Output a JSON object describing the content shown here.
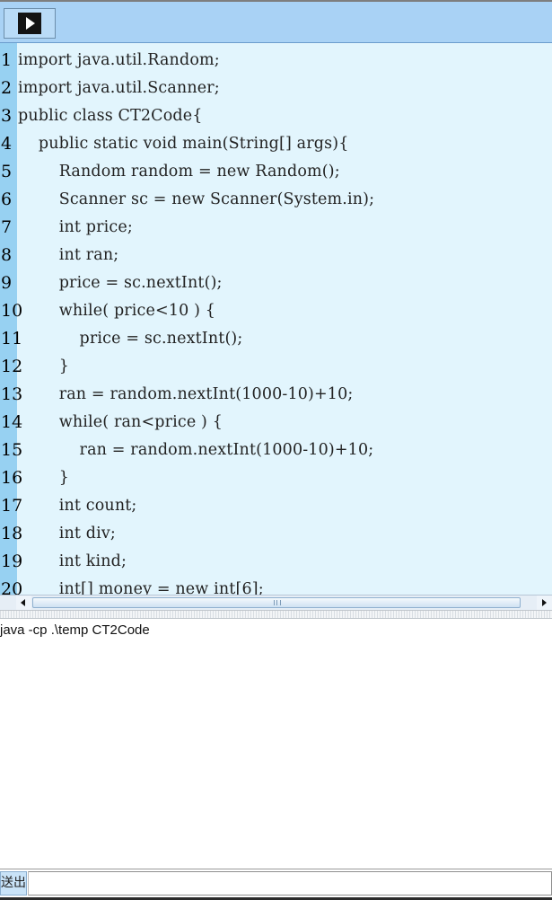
{
  "toolbar": {
    "run_icon": "play-icon"
  },
  "editor": {
    "lines": [
      {
        "num": "1",
        "code": "import java.util.Random;"
      },
      {
        "num": "2",
        "code": "import java.util.Scanner;"
      },
      {
        "num": "3",
        "code": "public class CT2Code{"
      },
      {
        "num": "4",
        "code": "    public static void main(String[] args){"
      },
      {
        "num": "5",
        "code": "        Random random = new Random();"
      },
      {
        "num": "6",
        "code": "        Scanner sc = new Scanner(System.in);"
      },
      {
        "num": "7",
        "code": "        int price;"
      },
      {
        "num": "8",
        "code": "        int ran;"
      },
      {
        "num": "9",
        "code": "        price = sc.nextInt();"
      },
      {
        "num": "10",
        "code": "        while( price<10 ) {"
      },
      {
        "num": "11",
        "code": "            price = sc.nextInt();"
      },
      {
        "num": "12",
        "code": "        }"
      },
      {
        "num": "13",
        "code": "        ran = random.nextInt(1000-10)+10;"
      },
      {
        "num": "14",
        "code": "        while( ran<price ) {"
      },
      {
        "num": "15",
        "code": "            ran = random.nextInt(1000-10)+10;"
      },
      {
        "num": "16",
        "code": "        }"
      },
      {
        "num": "17",
        "code": "        int count;"
      },
      {
        "num": "18",
        "code": "        int div;"
      },
      {
        "num": "19",
        "code": "        int kind;"
      },
      {
        "num": "20",
        "code": "        int[] money = new int[6];"
      }
    ]
  },
  "console": {
    "output": "java -cp .\\temp CT2Code"
  },
  "input_bar": {
    "send_label": "送出",
    "input_value": "",
    "input_placeholder": ""
  }
}
